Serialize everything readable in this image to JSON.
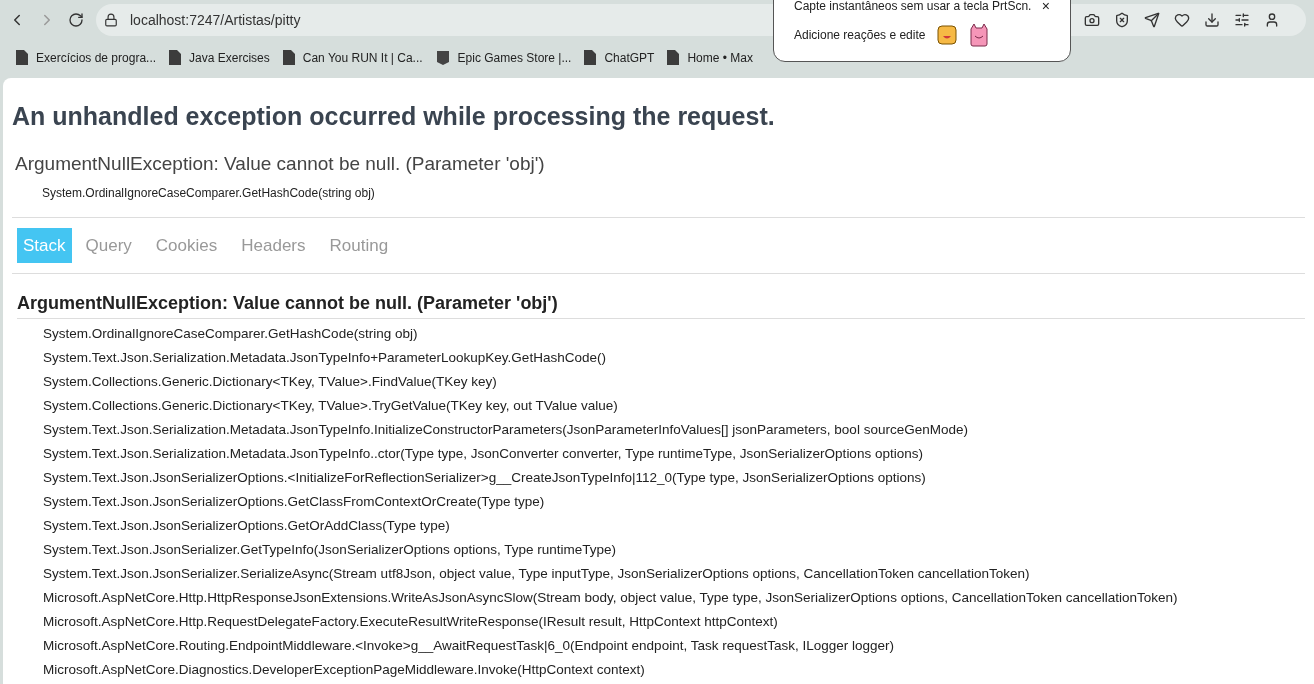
{
  "browser": {
    "url": "localhost:7247/Artistas/pitty",
    "bookmarks": [
      {
        "label": "Exercícios de progra...",
        "kind": "page"
      },
      {
        "label": "Java Exercises",
        "kind": "page"
      },
      {
        "label": "Can You RUN It | Ca...",
        "kind": "page"
      },
      {
        "label": "Epic Games Store |...",
        "kind": "epic"
      },
      {
        "label": "ChatGPT",
        "kind": "page"
      },
      {
        "label": "Home • Max",
        "kind": "page"
      }
    ],
    "popup": {
      "line1": "Capte instantâneos sem usar a tecla PrtScn.",
      "line2": "Adicione reações e edite",
      "close": "×"
    }
  },
  "page": {
    "title": "An unhandled exception occurred while processing the request.",
    "exception": "ArgumentNullException: Value cannot be null. (Parameter 'obj')",
    "location": "System.OrdinalIgnoreCaseComparer.GetHashCode(string obj)",
    "tabs": [
      {
        "label": "Stack",
        "selected": true
      },
      {
        "label": "Query",
        "selected": false
      },
      {
        "label": "Cookies",
        "selected": false
      },
      {
        "label": "Headers",
        "selected": false
      },
      {
        "label": "Routing",
        "selected": false
      }
    ],
    "stack_title": "ArgumentNullException: Value cannot be null. (Parameter 'obj')",
    "frames": [
      "System.OrdinalIgnoreCaseComparer.GetHashCode(string obj)",
      "System.Text.Json.Serialization.Metadata.JsonTypeInfo+ParameterLookupKey.GetHashCode()",
      "System.Collections.Generic.Dictionary<TKey, TValue>.FindValue(TKey key)",
      "System.Collections.Generic.Dictionary<TKey, TValue>.TryGetValue(TKey key, out TValue value)",
      "System.Text.Json.Serialization.Metadata.JsonTypeInfo.InitializeConstructorParameters(JsonParameterInfoValues[] jsonParameters, bool sourceGenMode)",
      "System.Text.Json.Serialization.Metadata.JsonTypeInfo..ctor(Type type, JsonConverter converter, Type runtimeType, JsonSerializerOptions options)",
      "System.Text.Json.JsonSerializerOptions.<InitializeForReflectionSerializer>g__CreateJsonTypeInfo|112_0(Type type, JsonSerializerOptions options)",
      "System.Text.Json.JsonSerializerOptions.GetClassFromContextOrCreate(Type type)",
      "System.Text.Json.JsonSerializerOptions.GetOrAddClass(Type type)",
      "System.Text.Json.JsonSerializer.GetTypeInfo(JsonSerializerOptions options, Type runtimeType)",
      "System.Text.Json.JsonSerializer.SerializeAsync(Stream utf8Json, object value, Type inputType, JsonSerializerOptions options, CancellationToken cancellationToken)",
      "Microsoft.AspNetCore.Http.HttpResponseJsonExtensions.WriteAsJsonAsyncSlow(Stream body, object value, Type type, JsonSerializerOptions options, CancellationToken cancellationToken)",
      "Microsoft.AspNetCore.Http.RequestDelegateFactory.ExecuteResultWriteResponse(IResult result, HttpContext httpContext)",
      "Microsoft.AspNetCore.Routing.EndpointMiddleware.<Invoke>g__AwaitRequestTask|6_0(Endpoint endpoint, Task requestTask, ILogger logger)",
      "Microsoft.AspNetCore.Diagnostics.DeveloperExceptionPageMiddleware.Invoke(HttpContext context)"
    ]
  }
}
